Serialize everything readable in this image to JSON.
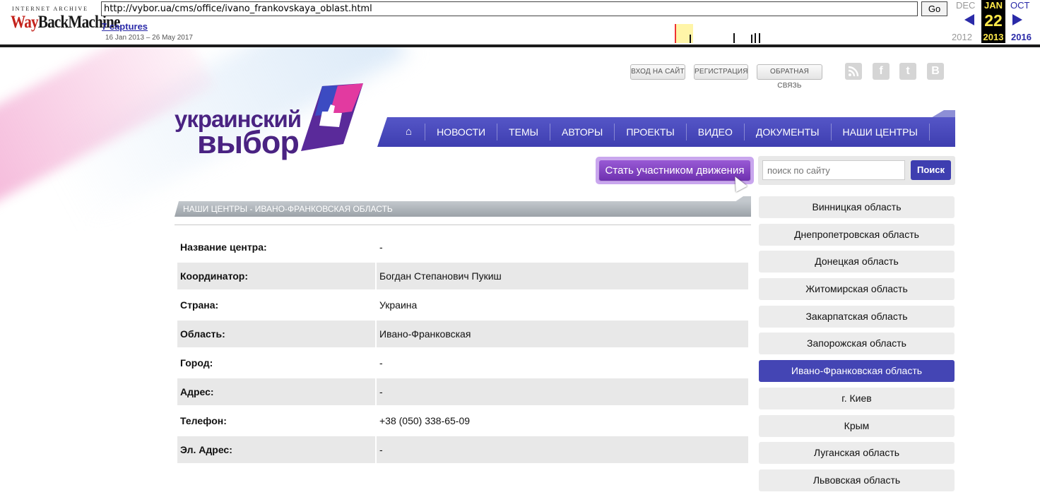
{
  "wayback": {
    "logo_top": "INTERNET ARCHIVE",
    "logo_way": "Way",
    "logo_back": "BackMachine",
    "url": "http://vybor.ua/cms/office/ivano_frankovskaya_oblast.html",
    "go_label": "Go",
    "captures": "7 captures",
    "range": "16 Jan 2013 – 26 May 2017",
    "prev_month": "DEC",
    "cur_month": "JAN",
    "next_month": "OCT",
    "day": "22",
    "prev_year": "2012",
    "cur_year": "2013",
    "next_year": "2016"
  },
  "top_links": {
    "login": "ВХОД НА САЙТ",
    "register": "РЕГИСТРАЦИЯ",
    "feedback": "ОБРАТНАЯ СВЯЗЬ"
  },
  "social": {
    "rss_icon": "rss-icon",
    "facebook": "f",
    "tumblr": "t",
    "vk": "B"
  },
  "logo": {
    "line1": "украинский",
    "line2": "выбор"
  },
  "nav": {
    "home_icon": "⌂",
    "items": [
      "НОВОСТИ",
      "ТЕМЫ",
      "АВТОРЫ",
      "ПРОЕКТЫ",
      "ВИДЕО",
      "ДОКУМЕНТЫ",
      "НАШИ ЦЕНТРЫ"
    ]
  },
  "join_button": "Стать участником движения",
  "search": {
    "placeholder": "поиск по сайту",
    "button": "Поиск"
  },
  "section_title": "НАШИ ЦЕНТРЫ - ИВАНО-ФРАНКОВСКАЯ ОБЛАСТЬ",
  "center_info": [
    {
      "label": "Название центра:",
      "value": "-"
    },
    {
      "label": "Координатор:",
      "value": "Богдан Степанович Пукиш"
    },
    {
      "label": "Страна:",
      "value": "Украина"
    },
    {
      "label": "Область:",
      "value": "Ивано-Франковская"
    },
    {
      "label": "Город:",
      "value": "-"
    },
    {
      "label": "Адрес:",
      "value": "-"
    },
    {
      "label": "Телефон:",
      "value": "+38 (050) 338-65-09"
    },
    {
      "label": "Эл. Адрес:",
      "value": "-"
    }
  ],
  "regions": {
    "active": "Ивано-Франковская область",
    "items": [
      "Винницкая область",
      "Днепропетровская область",
      "Донецкая область",
      "Житомирская область",
      "Закарпатская область",
      "Запорожская область",
      "Ивано-Франковская область",
      "г. Киев",
      "Крым",
      "Луганская область",
      "Львовская область"
    ]
  },
  "colors": {
    "brand_purple": "#4a2382",
    "nav_blue": "#3e3eb0",
    "active_region": "#4445b4"
  }
}
